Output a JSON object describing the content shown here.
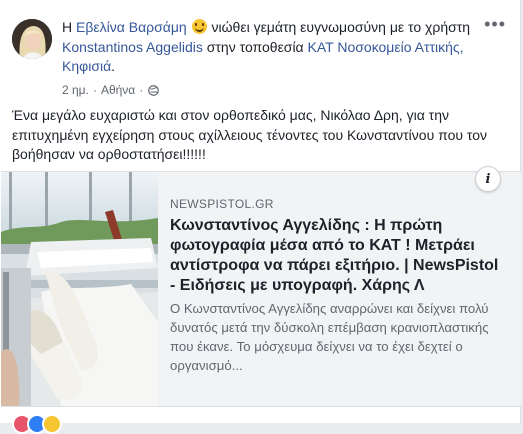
{
  "post": {
    "author_name": "Εβελίνα Βαρσάμη",
    "feeling_text": "νιώθει γεμάτη ευγνωμοσύνη με το χρήστη",
    "tagged_user": "Konstantinos Aggelidis",
    "location_prefix": "στην τοποθεσία",
    "location_name": "ΚΑΤ Νοσοκομείο Αττικής, Κηφισιά",
    "location_suffix": ".",
    "timestamp": "2 ημ.",
    "place": "Αθήνα",
    "separator": "·",
    "privacy_icon": "globe-icon",
    "more_label": "•••",
    "body_text": "Ένα μεγάλο ευχαριστώ και στον ορθοπεδικό μας, Νικόλαο Δρη, για την επιτυχημένη εγχείρηση στους αχίλλειους τένοντες του Κωνσταντίνου που τον βοήθησαν να ορθοστατήσει!!!!!!"
  },
  "link_card": {
    "source": "NEWSPISTOL.GR",
    "title": "Κωνσταντίνος Αγγελίδης : Η πρώτη φωτογραφία μέσα από το ΚΑΤ ! Μετράει αντίστροφα να πάρει εξιτήριο. | NewsPistol - Ειδήσεις με υπογραφή. Χάρης Λ",
    "description": "Ο Κωνσταντίνος Αγγελίδης αναρρώνει και δείχνει πολύ δυνατός μετά την δύσκολη επέμβαση κρανιοπλαστικής που έκανε. Το μόσχευμα δείχνει να το έχει δεχτεί ο οργανισμό...",
    "info_label": "i"
  },
  "colors": {
    "link": "#365899",
    "text": "#1d2129",
    "meta": "#616770",
    "card_bg": "#f2f3f5"
  }
}
